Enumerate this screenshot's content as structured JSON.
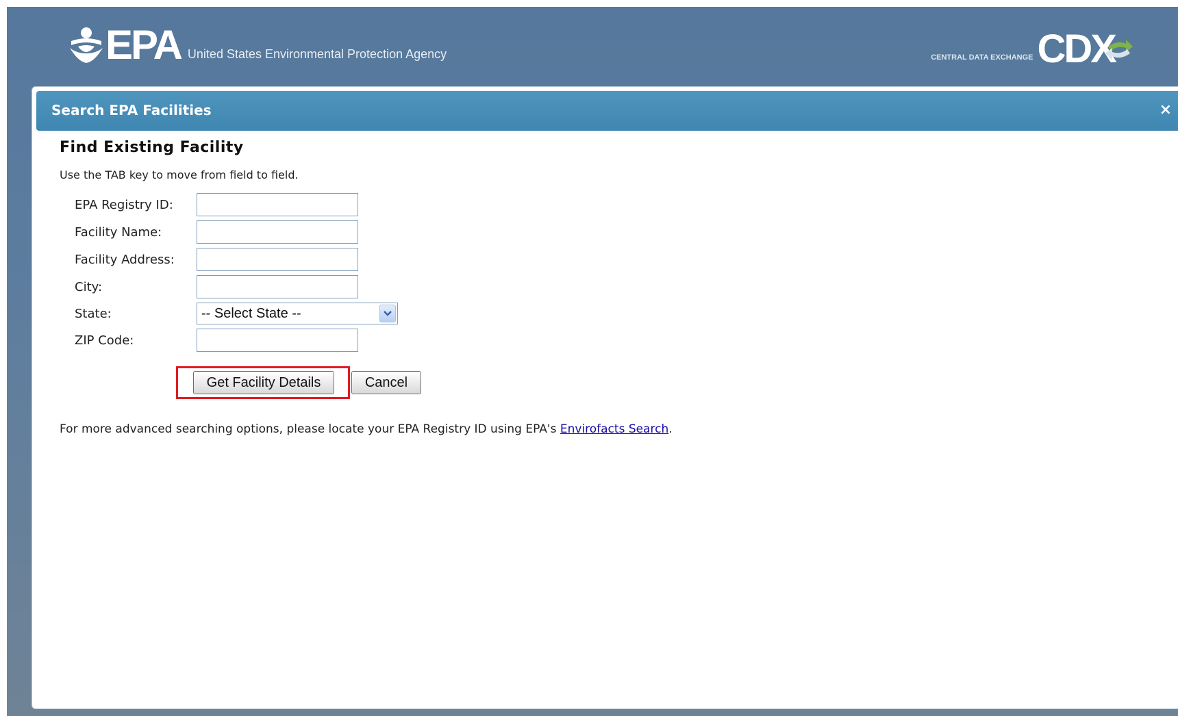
{
  "header": {
    "epa_logo_text": "EPA",
    "agency_name": "United States Environmental Protection Agency",
    "cdx_subtitle": "CENTRAL DATA EXCHANGE",
    "cdx_logo_text": "CDX"
  },
  "dialog": {
    "title": "Search EPA Facilities",
    "close_glyph": "×",
    "section_title": "Find Existing Facility",
    "instructions": "Use the TAB key to move from field to field.",
    "fields": {
      "registry_id": {
        "label": "EPA Registry ID:",
        "value": ""
      },
      "facility_name": {
        "label": "Facility Name:",
        "value": ""
      },
      "facility_address": {
        "label": "Facility Address:",
        "value": ""
      },
      "city": {
        "label": "City:",
        "value": ""
      },
      "state": {
        "label": "State:",
        "selected": "-- Select State --"
      },
      "zip": {
        "label": "ZIP Code:",
        "value": ""
      }
    },
    "buttons": {
      "submit_label": "Get Facility Details",
      "cancel_label": "Cancel"
    },
    "footer": {
      "text_before_link": "For more advanced searching options, please locate your EPA Registry ID using EPA's ",
      "link_text": "Envirofacts Search",
      "text_after_link": "."
    }
  },
  "colors": {
    "header_bg": "#55789c",
    "dialog_bar": "#4189b5",
    "highlight_border": "#e11b22",
    "link": "#1a0dab"
  },
  "icons": {
    "epa": "epa-flower-icon",
    "cdx": "cdx-exchange-arrow-icon",
    "close": "close-icon",
    "dropdown": "chevron-down-icon"
  }
}
